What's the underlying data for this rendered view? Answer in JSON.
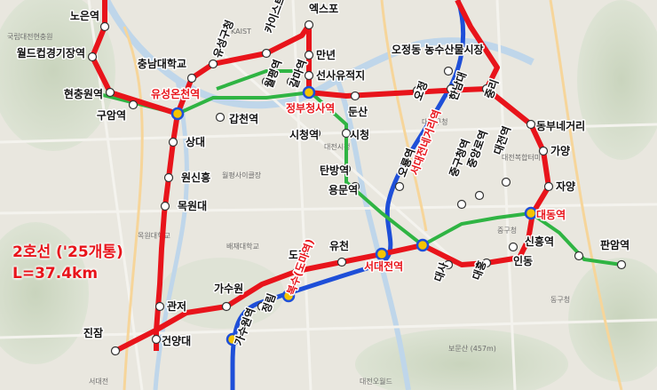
{
  "title": {
    "line_label": "2호선 ('25개통)",
    "length_label": "L=37.4km"
  },
  "colors": {
    "line2_red": "#e8141b",
    "line1_blue": "#1e4fd8",
    "bus_green": "#2fb443",
    "transfer_yellow": "#f5c400",
    "river": "#bfd6ea",
    "station_fill": "#ffffff"
  },
  "stations": [
    {
      "id": "noeun",
      "label": "노은역",
      "transfer": false
    },
    {
      "id": "worldcup",
      "label": "월드컵경기장역",
      "transfer": false
    },
    {
      "id": "hyeonchungwon",
      "label": "현충원역",
      "transfer": false
    },
    {
      "id": "guam",
      "label": "구암역",
      "transfer": false
    },
    {
      "id": "yuseong",
      "label": "유성온천역",
      "transfer": true
    },
    {
      "id": "chungnam",
      "label": "충남대학교",
      "transfer": false
    },
    {
      "id": "yuseonggu",
      "label": "유성구청",
      "transfer": false
    },
    {
      "id": "kaist",
      "label": "카이스트",
      "transfer": false
    },
    {
      "id": "expo",
      "label": "엑스포",
      "transfer": false
    },
    {
      "id": "wolpyeong",
      "label": "월평역",
      "transfer": false
    },
    {
      "id": "galma",
      "label": "갈마역",
      "transfer": false
    },
    {
      "id": "manyeon",
      "label": "만년",
      "transfer": false
    },
    {
      "id": "seonsa",
      "label": "선사유적지",
      "transfer": false
    },
    {
      "id": "gapcheon",
      "label": "갑천역",
      "transfer": false
    },
    {
      "id": "government",
      "label": "정부청사역",
      "transfer": true
    },
    {
      "id": "dunsan",
      "label": "둔산",
      "transfer": false
    },
    {
      "id": "cityhall",
      "label": "시청역",
      "transfer": false
    },
    {
      "id": "sicheong",
      "label": "시청",
      "transfer": false
    },
    {
      "id": "sangdae",
      "label": "상대",
      "transfer": false
    },
    {
      "id": "wonsinheung",
      "label": "원신흥",
      "transfer": false
    },
    {
      "id": "mokwon",
      "label": "목원대",
      "transfer": false
    },
    {
      "id": "tanbang",
      "label": "탄방역",
      "transfer": false
    },
    {
      "id": "yongmun",
      "label": "용문역",
      "transfer": false
    },
    {
      "id": "ojeong",
      "label": "오정동 농수산물시장",
      "transfer": false
    },
    {
      "id": "ojeong2",
      "label": "오정",
      "transfer": false
    },
    {
      "id": "hannam",
      "label": "한남대",
      "transfer": false
    },
    {
      "id": "jungni",
      "label": "중리",
      "transfer": false
    },
    {
      "id": "dongbu",
      "label": "동부네거리",
      "transfer": false
    },
    {
      "id": "gayang",
      "label": "가양",
      "transfer": false
    },
    {
      "id": "jayang",
      "label": "자양",
      "transfer": false
    },
    {
      "id": "daedong",
      "label": "대동역",
      "transfer": true
    },
    {
      "id": "sinheung",
      "label": "신흥역",
      "transfer": false
    },
    {
      "id": "panam",
      "label": "판암역",
      "transfer": false
    },
    {
      "id": "indong",
      "label": "인동",
      "transfer": false
    },
    {
      "id": "daeheung",
      "label": "대흥",
      "transfer": false
    },
    {
      "id": "daesa",
      "label": "대사",
      "transfer": false
    },
    {
      "id": "seodaejeon_ne",
      "label": "서대전네거리역",
      "transfer": true
    },
    {
      "id": "seodaejeon",
      "label": "서대전역",
      "transfer": true
    },
    {
      "id": "oryong",
      "label": "오룡역",
      "transfer": false
    },
    {
      "id": "junggucheong",
      "label": "중구청역",
      "transfer": false
    },
    {
      "id": "jungangro",
      "label": "중앙로역",
      "transfer": false
    },
    {
      "id": "daejeon",
      "label": "대전역",
      "transfer": false
    },
    {
      "id": "yucheon",
      "label": "유천",
      "transfer": false
    },
    {
      "id": "doma",
      "label": "도마",
      "transfer": false
    },
    {
      "id": "boksu",
      "label": "복수(도마역)",
      "transfer": true
    },
    {
      "id": "jeongnim",
      "label": "정림",
      "transfer": false
    },
    {
      "id": "gasuwon",
      "label": "가수원",
      "transfer": false
    },
    {
      "id": "gasuwonyeok",
      "label": "가수원역",
      "transfer": true
    },
    {
      "id": "gwanjeo",
      "label": "관저",
      "transfer": false
    },
    {
      "id": "geonyang",
      "label": "건양대",
      "transfer": false
    },
    {
      "id": "jinjam",
      "label": "진잠",
      "transfer": false
    }
  ],
  "background_labels": [
    {
      "id": "b1",
      "label": "국립대전현충원"
    },
    {
      "id": "b2",
      "label": "KAIST"
    },
    {
      "id": "b3",
      "label": "대전시청"
    },
    {
      "id": "b4",
      "label": "대덕구청"
    },
    {
      "id": "b5",
      "label": "대전복합터미널"
    },
    {
      "id": "b6",
      "label": "동구청"
    },
    {
      "id": "b7",
      "label": "중구청"
    },
    {
      "id": "b8",
      "label": "배재대학교"
    },
    {
      "id": "b9",
      "label": "목원대학교"
    },
    {
      "id": "b10",
      "label": "월평사이클장"
    },
    {
      "id": "b11",
      "label": "보문산 (457m)"
    },
    {
      "id": "b12",
      "label": "대전오월드"
    },
    {
      "id": "b13",
      "label": "서대전"
    }
  ]
}
